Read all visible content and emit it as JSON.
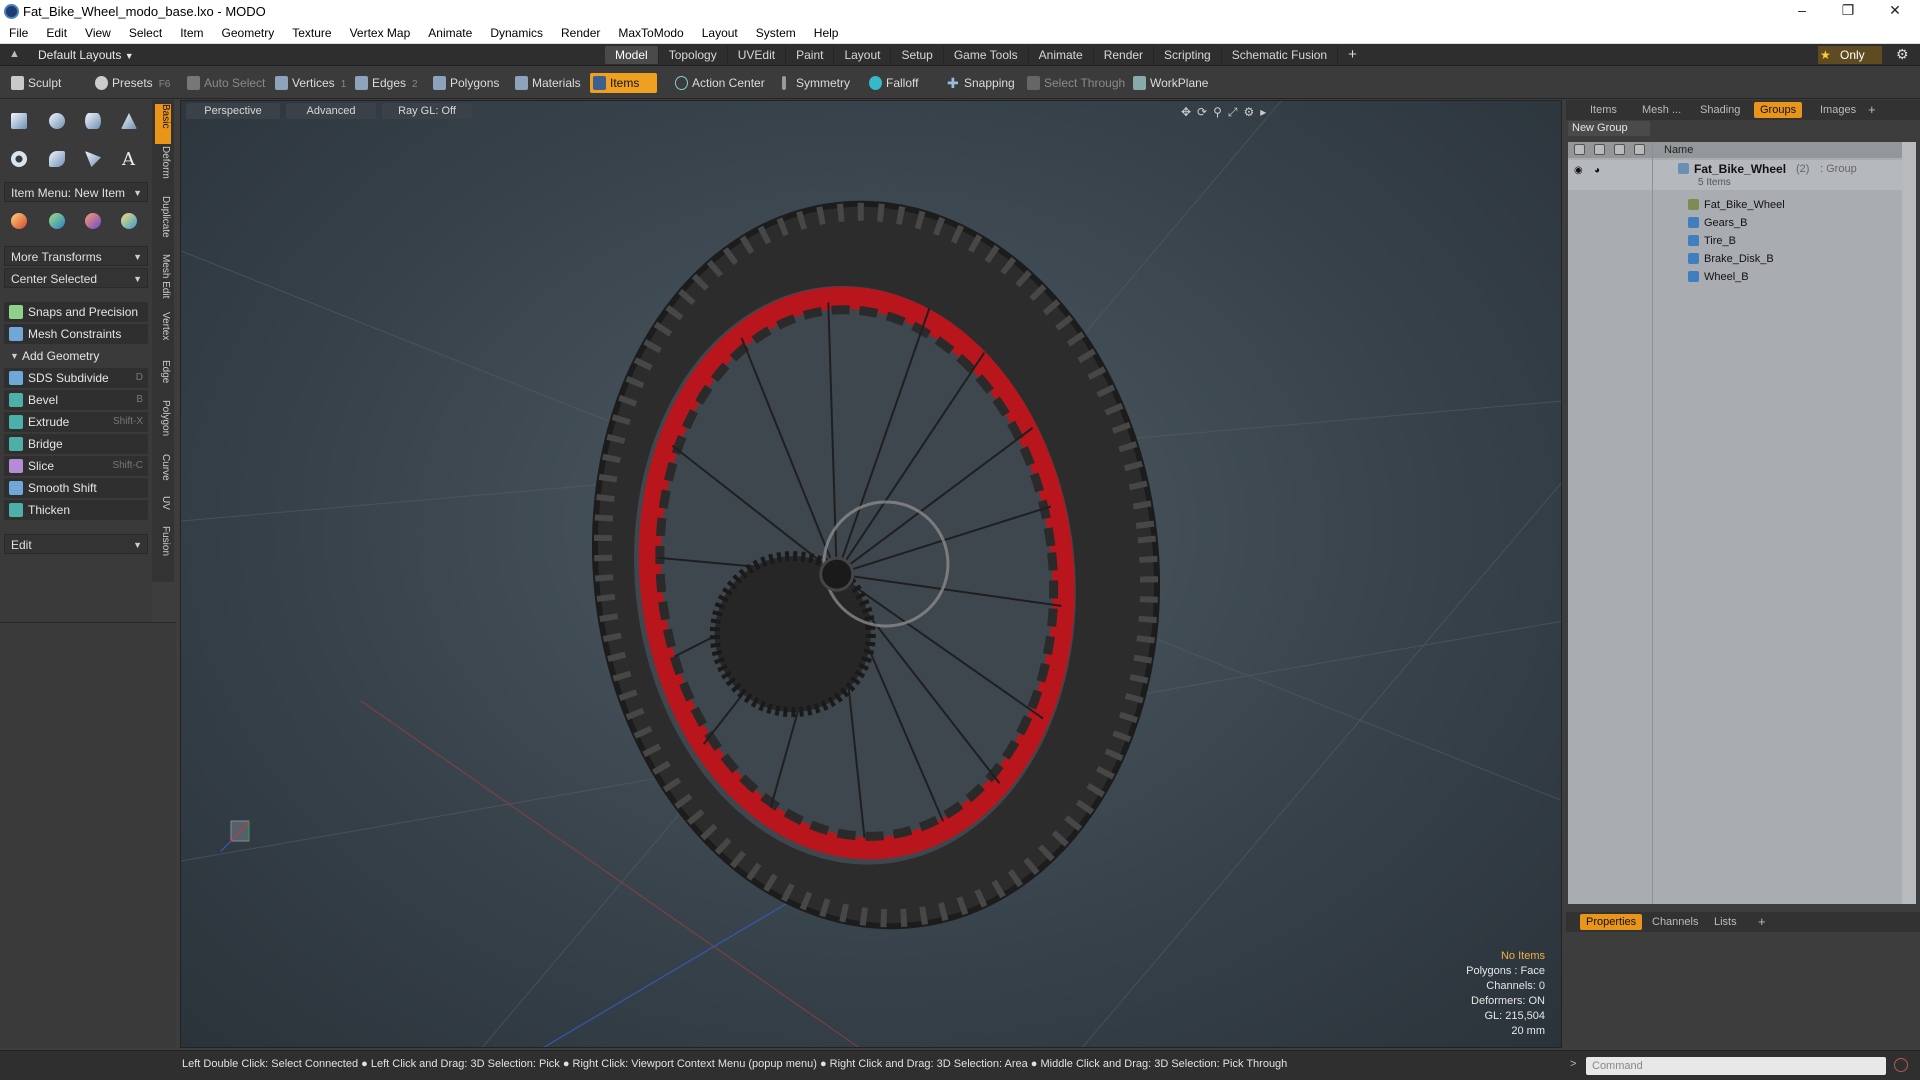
{
  "window": {
    "title": "Fat_Bike_Wheel_modo_base.lxo - MODO",
    "controls": [
      "minimize-icon",
      "restore-icon",
      "close-icon"
    ]
  },
  "menubar": [
    "File",
    "Edit",
    "View",
    "Select",
    "Item",
    "Geometry",
    "Texture",
    "Vertex Map",
    "Animate",
    "Dynamics",
    "Render",
    "MaxToModo",
    "Layout",
    "System",
    "Help"
  ],
  "layoutbar": {
    "layout_dropdown": "Default Layouts",
    "tabs": [
      "Model",
      "Topology",
      "UVEdit",
      "Paint",
      "Layout",
      "Setup",
      "Game Tools",
      "Animate",
      "Render",
      "Scripting",
      "Schematic Fusion"
    ],
    "active_tab": "Model",
    "add": "+",
    "only_label": "Only"
  },
  "toolbar": {
    "sculpt": "Sculpt",
    "presets": "Presets",
    "presets_shortcut": "F6",
    "auto_select": "Auto Select",
    "vertices": "Vertices",
    "vertices_key": "1",
    "edges": "Edges",
    "edges_key": "2",
    "polygons": "Polygons",
    "materials": "Materials",
    "items": "Items",
    "action_center": "Action Center",
    "symmetry": "Symmetry",
    "falloff": "Falloff",
    "snapping": "Snapping",
    "select_through": "Select Through",
    "workplane": "WorkPlane"
  },
  "leftpanel": {
    "item_menu": "Item Menu: New Item",
    "more_transforms": "More Transforms",
    "center_selected": "Center Selected",
    "snaps": "Snaps and Precision",
    "mesh_constraints": "Mesh Constraints",
    "add_geometry": "Add Geometry",
    "tools": [
      {
        "label": "SDS Subdivide",
        "shortcut": "D"
      },
      {
        "label": "Bevel",
        "shortcut": "B"
      },
      {
        "label": "Extrude",
        "shortcut": "Shift-X"
      },
      {
        "label": "Bridge",
        "shortcut": ""
      },
      {
        "label": "Slice",
        "shortcut": "Shift-C"
      },
      {
        "label": "Smooth Shift",
        "shortcut": ""
      },
      {
        "label": "Thicken",
        "shortcut": ""
      }
    ],
    "edit_dropdown": "Edit",
    "vertical_tabs": [
      "Basic",
      "Deform",
      "Duplicate",
      "Mesh Edit",
      "Vertex",
      "Edge",
      "Polygon",
      "Curve",
      "UV",
      "Fusion"
    ]
  },
  "viewport": {
    "view_mode": "Perspective",
    "shading": "Advanced",
    "raygl": "Ray GL: Off",
    "stats": {
      "selection": "No Items",
      "polygons": "Polygons : Face",
      "channels": "Channels: 0",
      "deformers": "Deformers: ON",
      "gl": "GL: 215,504",
      "scale": "20 mm"
    },
    "rim_color": "#b8161c",
    "tire_color": "#2c2c2c"
  },
  "rightpanel": {
    "tabs": [
      "Items",
      "Mesh ...",
      "Shading",
      "Groups",
      "Images"
    ],
    "active_tab": "Groups",
    "new_group": "New Group",
    "column_name": "Name",
    "group": {
      "name": "Fat_Bike_Wheel",
      "count": "(2)",
      "type": ": Group",
      "subtitle": "5 Items"
    },
    "children": [
      "Fat_Bike_Wheel",
      "Gears_B",
      "Tire_B",
      "Brake_Disk_B",
      "Wheel_B"
    ],
    "bottom_tabs": [
      "Properties",
      "Channels",
      "Lists"
    ],
    "bottom_active": "Properties"
  },
  "statusbar": {
    "message": "Left Double Click: Select Connected ● Left Click and Drag: 3D Selection: Pick ● Right Click: Viewport Context Menu (popup menu) ● Right Click and Drag: 3D Selection: Area ● Middle Click and Drag: 3D Selection: Pick Through",
    "command_placeholder": "Command"
  }
}
